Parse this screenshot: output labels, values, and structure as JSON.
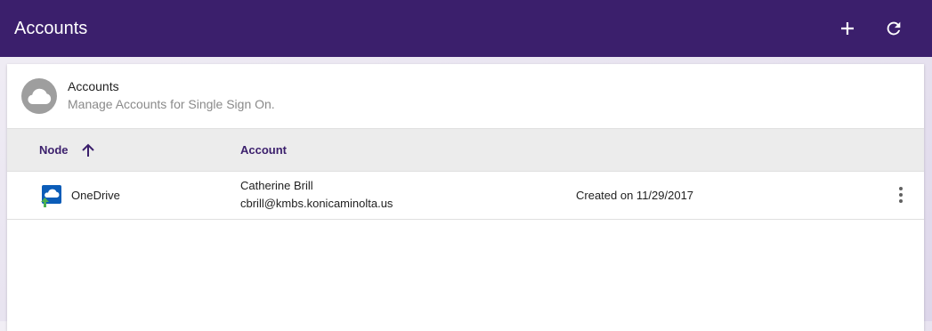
{
  "appbar": {
    "title": "Accounts",
    "actions": [
      {
        "name": "add",
        "icon": "plus-icon"
      },
      {
        "name": "refresh",
        "icon": "refresh-icon"
      }
    ]
  },
  "card": {
    "icon": "cloud-icon",
    "title": "Accounts",
    "subtitle": "Manage Accounts for Single Sign On."
  },
  "table": {
    "columns": [
      {
        "label": "Node",
        "sorted": "ascending"
      },
      {
        "label": "Account"
      }
    ],
    "rows": [
      {
        "node_icon": "onedrive-icon",
        "node": "OneDrive",
        "account_name": "Catherine Brill",
        "account_email": "cbrill@kmbs.konicaminolta.us",
        "created": "Created on 11/29/2017",
        "menu_icon": "more-vert-icon"
      }
    ]
  },
  "colors": {
    "appbar": "#3b1f6c",
    "header_text": "#3b1f6c",
    "onedrive_blue": "#0b5cb8",
    "upload_arrow": "#4caf50"
  }
}
